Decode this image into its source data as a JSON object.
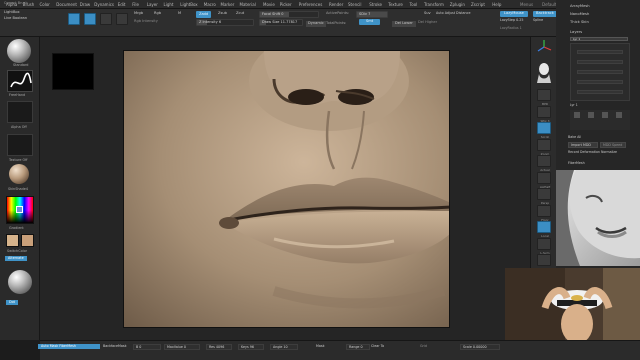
{
  "menu": [
    "Alpha",
    "Brush",
    "Color",
    "Document",
    "Draw",
    "Dynamics",
    "Edit",
    "File",
    "Layer",
    "Light",
    "LightBox",
    "Macro",
    "Marker",
    "Material",
    "Movie",
    "Picker",
    "Preferences",
    "Render",
    "Stencil",
    "Stroke",
    "Texture",
    "Tool",
    "Transform",
    "Zplugin",
    "Zscript",
    "Help"
  ],
  "menu_right": [
    "Menus",
    "DefaultZScript"
  ],
  "topshelf": {
    "lightbox": "LightBox",
    "live_boolean": "Live Boolean",
    "current_brush": "Current Brush",
    "edit": "Edit",
    "draw": "Draw",
    "move": "Move",
    "scale": "Scale",
    "rotate": "Rotate",
    "mrgb": "Mrgb",
    "rgb": "Rgb",
    "m": "M",
    "rgb_intensity": "Rgb Intensity",
    "zadd": "Zadd",
    "zsub": "Zsub",
    "zcut": "Zcut",
    "z_intensity": "Z Intensity 6",
    "focal_shift": "Focal Shift 0",
    "draw_size": "Draw Size 11.77817",
    "dynamic": "Dynamic",
    "active_points": "ActivePoints:",
    "total_points": "TotalPoints:",
    "sdiv": "SDiv 7",
    "cmp": "Cmp",
    "smt": "Smt",
    "suv": "Suv",
    "auto_adjust": "Auto Adjust Distance",
    "del_lower": "Del Lower",
    "del_higher": "Del Higher",
    "reconstruct": "Reconstruct Subdiv",
    "lazy_mouse": "LazyMouse",
    "lazy_step": "LazyStep 0.25",
    "lazy_radius": "LazyRadius 1",
    "backtrack": "Backtrack",
    "plane": "Plane",
    "spline": "Spline"
  },
  "leftshelf": {
    "brush_label": "Standard",
    "stroke_label": "FreeHand",
    "alpha_label": "Alpha Off",
    "texture_label": "Texture Off",
    "material_label": "SkinShade4",
    "gradient_label": "Gradient",
    "switch_label": "SwitchColor",
    "alternate_label": "Alternate",
    "mat_label": "Dot",
    "primary_color": "#6a8fd8"
  },
  "rightshelf": [
    {
      "name": "bpr",
      "cap": "BPR"
    },
    {
      "name": "spix",
      "cap": "SPix 3"
    },
    {
      "name": "scroll",
      "cap": "Scroll"
    },
    {
      "name": "zoom",
      "cap": "Zoom"
    },
    {
      "name": "actual",
      "cap": "Actual"
    },
    {
      "name": "aahalf",
      "cap": "AAHalf"
    },
    {
      "name": "persp",
      "cap": "Persp"
    },
    {
      "name": "floor",
      "cap": "Floor"
    },
    {
      "name": "local",
      "cap": "Local"
    },
    {
      "name": "lsym",
      "cap": "L.Sym"
    },
    {
      "name": "xyz",
      "cap": "Xyz"
    },
    {
      "name": "frame",
      "cap": "Frame"
    },
    {
      "name": "move",
      "cap": "Move"
    },
    {
      "name": "scale",
      "cap": "Scale"
    },
    {
      "name": "rotate",
      "cap": "Rotate"
    }
  ],
  "palette": {
    "items": [
      "ArrayMesh",
      "NanoMesh",
      "Thick Skin"
    ],
    "layers": "Layers",
    "layer_name": "Lyr 1",
    "layer_row": "Lyr 1",
    "bake_all": "Bake All",
    "import_mdd": "Import MDD",
    "mdd_speed": "MDD Speed",
    "record_deform": "Record Deformation Normalize",
    "fibermesh": "FiberMesh"
  },
  "bottomshelf": {
    "active": "Auto Mask FiberMesh",
    "backface": "BackfaceMask",
    "b": "B 0",
    "maxvalue": "MaxValue 0",
    "res": "Res 4096",
    "keys": "Keys 96",
    "angle": "Angle 10",
    "mask": "Mask",
    "range": "Range 0",
    "clear_to": "Clear To",
    "grid": "Grid",
    "scale": "Scale 0.00000"
  },
  "colors": {
    "accent": "#3f93c8",
    "skin_mid": "#a58e74"
  }
}
